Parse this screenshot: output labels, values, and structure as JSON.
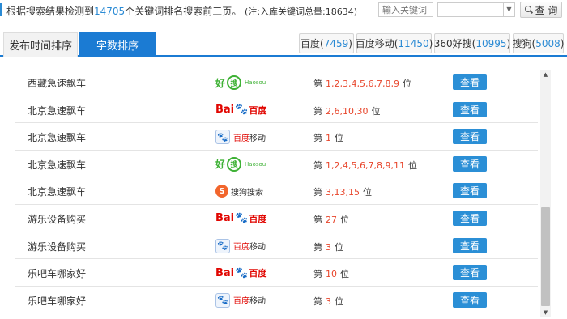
{
  "header": {
    "summary_prefix": "根据搜索结果检测到",
    "keyword_count": "14705",
    "summary_suffix": "个关键词排名搜索前三页。",
    "note": "(注:入库关键词总量:18634)",
    "search_placeholder": "输入关键词",
    "query_label": "查 询"
  },
  "tabs": [
    {
      "label": "发布时间排序",
      "active": false
    },
    {
      "label": "字数排序",
      "active": true
    }
  ],
  "engines": [
    {
      "name": "百度",
      "count": "7459"
    },
    {
      "name": "百度移动",
      "count": "11450"
    },
    {
      "name": "360好搜",
      "count": "10995"
    },
    {
      "name": "搜狗",
      "count": "5008"
    }
  ],
  "logos": {
    "haosou_hao": "好",
    "haosou_sou": "搜",
    "haosou_en": "Haosou",
    "baidu_bai": "Bai",
    "baidu_paw": "🐾",
    "baidu_du": "百度",
    "bdm_text_a": "百度",
    "bdm_text_b": "移动",
    "sogou_s": "S",
    "sogou_text": "搜狗搜索"
  },
  "rank_prefix": "第",
  "rank_suffix": "位",
  "view_label": "查看",
  "rows": [
    {
      "keyword": "西藏急速飘车",
      "engine": "360",
      "positions": "1,2,3,4,5,6,7,8,9"
    },
    {
      "keyword": "北京急速飘车",
      "engine": "baidu",
      "positions": "2,6,10,30"
    },
    {
      "keyword": "北京急速飘车",
      "engine": "baidu-mobile",
      "positions": "1"
    },
    {
      "keyword": "北京急速飘车",
      "engine": "360",
      "positions": "1,2,4,5,6,7,8,9,11"
    },
    {
      "keyword": "北京急速飘车",
      "engine": "sogou",
      "positions": "3,13,15"
    },
    {
      "keyword": "游乐设备购买",
      "engine": "baidu",
      "positions": "27"
    },
    {
      "keyword": "游乐设备购买",
      "engine": "baidu-mobile",
      "positions": "3"
    },
    {
      "keyword": "乐吧车哪家好",
      "engine": "baidu",
      "positions": "10"
    },
    {
      "keyword": "乐吧车哪家好",
      "engine": "baidu-mobile",
      "positions": "3"
    }
  ],
  "colors": {
    "accent": "#1b7bd3",
    "count": "#2a8ad4",
    "position": "#e8462c",
    "button": "#2b8fd6"
  }
}
